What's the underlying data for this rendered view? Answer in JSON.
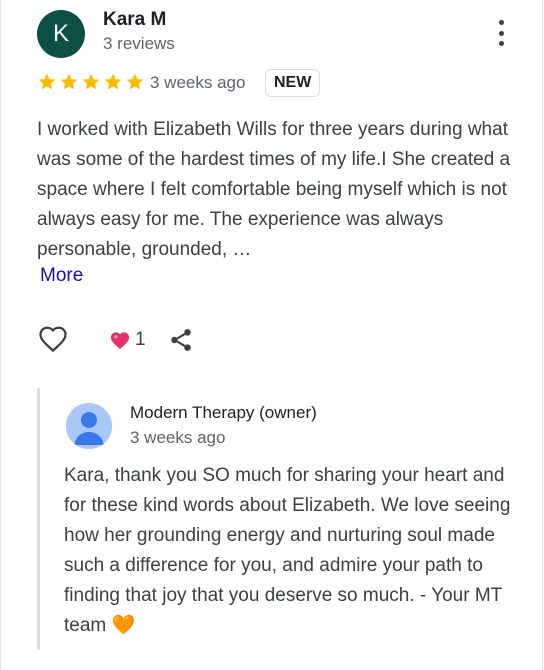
{
  "review": {
    "author_initial": "K",
    "author_name": "Kara M",
    "author_meta": "3 reviews",
    "rating": 5,
    "date": "3 weeks ago",
    "badge": "NEW",
    "text": "I worked with Elizabeth Wills for three years during what was some of the hardest times of my life.I She created a space where I felt comfortable being myself which is not always easy for me. The experience was always personable, grounded, …",
    "more_label": "More",
    "reaction_count": "1"
  },
  "reply": {
    "owner_name": "Modern Therapy (owner)",
    "date": "3 weeks ago",
    "text": "Kara, thank you SO much for sharing your heart and for these kind words about Elizabeth. We love seeing how her grounding energy and nurturing soul made such a difference for you, and admire your path to finding that joy that you deserve so much. - Your MT team",
    "emoji": "🧡"
  },
  "colors": {
    "avatar_bg": "#0b4f46",
    "star": "#fbbc04",
    "link": "#1a0dab",
    "heart": "#e5316b",
    "orange_heart": "#f57c3a"
  },
  "icons": [
    "more-vert-icon",
    "star-icon",
    "heart-outline-icon",
    "heart-reaction-icon",
    "share-icon",
    "person-avatar-icon",
    "orange-heart-emoji"
  ]
}
